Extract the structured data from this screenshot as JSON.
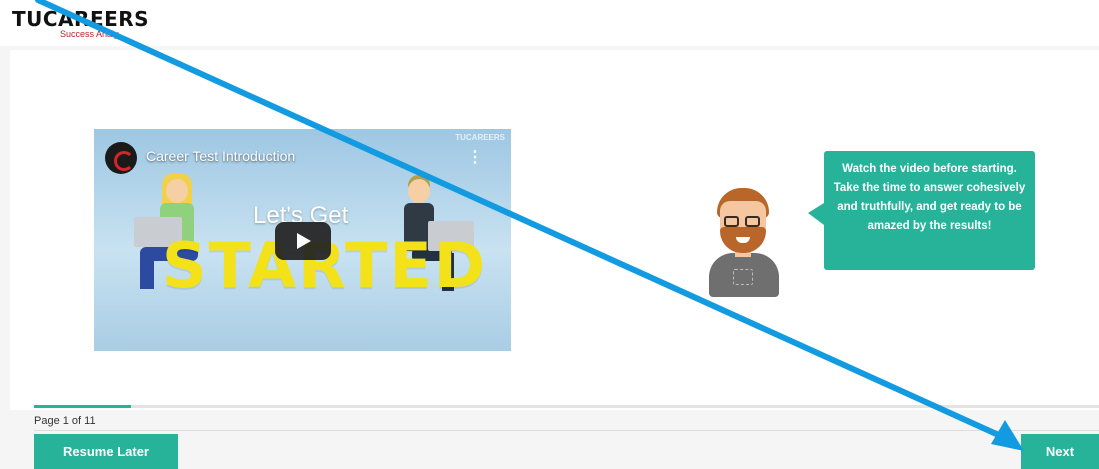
{
  "brand": {
    "logo_text": "TUCAREERS",
    "tagline": "Success Analy",
    "accent_color": "#26b39a",
    "logo_red": "#c0202a"
  },
  "video": {
    "channel_icon": "tucareers-channel-icon",
    "title": "Career Test Introduction",
    "menu_icon": "more-vertical-icon",
    "watermark": "TUCAREERS",
    "headline_small": "Let's Get",
    "headline_big": "STARTED",
    "play_icon": "play-icon"
  },
  "assistant": {
    "message": "Watch the video before starting. Take the time to answer cohesively and truthfully, and get ready to be amazed by the results!"
  },
  "progress": {
    "label": "Page 1 of 11",
    "fraction": 0.0909
  },
  "buttons": {
    "resume_label": "Resume Later",
    "next_label": "Next"
  },
  "annotation": {
    "arrow_color": "#129be0"
  }
}
